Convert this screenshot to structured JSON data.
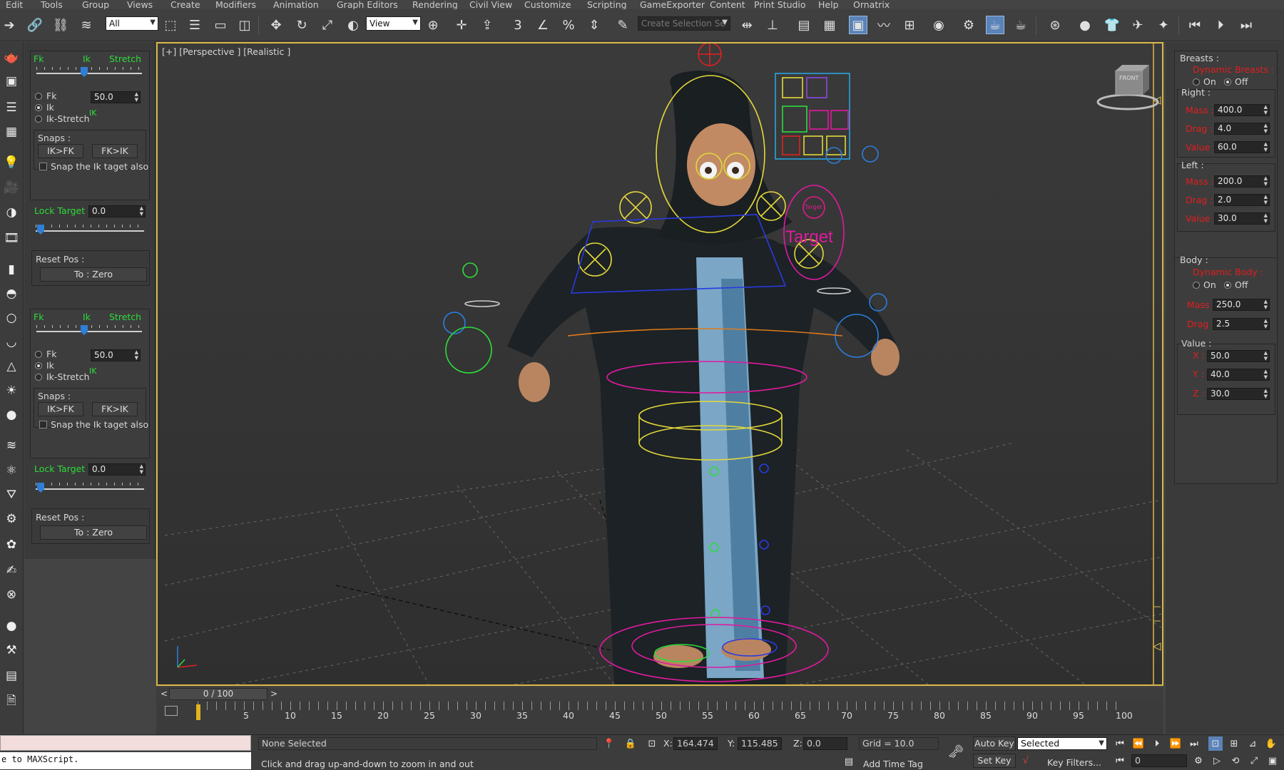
{
  "menubar": {
    "items": [
      "Edit",
      "Tools",
      "Group",
      "Views",
      "Create",
      "Modifiers",
      "Animation",
      "Graph Editors",
      "Rendering",
      "Civil View",
      "Customize",
      "Scripting",
      "GameExporter",
      "Content",
      "Print Studio",
      "Help",
      "Ornatrix"
    ]
  },
  "toolbar": {
    "selection_filter": "All",
    "reference_coord": "View",
    "named_selection_placeholder": "Create Selection Se"
  },
  "left_panel": {
    "groups": [
      {
        "fk_label": "Fk",
        "ik_label": "Ik",
        "stretch_label": "Stretch",
        "radio_fk": "Fk",
        "radio_ik": "Ik",
        "radio_ikstretch": "Ik-Stretch",
        "blend_value": "50.0",
        "mode_indicator": "IK",
        "slider_percent": 50,
        "snaps_label": "Snaps :",
        "ik_to_fk": "IK>FK",
        "fk_to_ik": "FK>IK",
        "snap_checkbox_label": "Snap the Ik taget also",
        "lock_target_label": "Lock Target",
        "lock_target_value": "0.0",
        "lock_slider_percent": 0,
        "reset_pos_label": "Reset Pos :",
        "to_zero": "To : Zero"
      },
      {
        "fk_label": "Fk",
        "ik_label": "Ik",
        "stretch_label": "Stretch",
        "radio_fk": "Fk",
        "radio_ik": "Ik",
        "radio_ikstretch": "Ik-Stretch",
        "blend_value": "50.0",
        "mode_indicator": "IK",
        "slider_percent": 50,
        "snaps_label": "Snaps :",
        "ik_to_fk": "IK>FK",
        "fk_to_ik": "FK>IK",
        "snap_checkbox_label": "Snap the Ik taget also",
        "lock_target_label": "Lock Target",
        "lock_target_value": "0.0",
        "lock_slider_percent": 0,
        "reset_pos_label": "Reset Pos :",
        "to_zero": "To : Zero"
      }
    ]
  },
  "viewport": {
    "label": "[+] [Perspective ] [Realistic ]",
    "target_text": "Target",
    "target_small": "Target",
    "viewcube_face": "FRONT"
  },
  "right_panel": {
    "breasts_label": "Breasts :",
    "dynamic_breasts": "Dynamic Breasts :",
    "on": "On",
    "off": "Off",
    "right_label": "Right :",
    "mass_label": "Mass :",
    "drag_label": "Drag :",
    "value_label": "Value :",
    "right_mass": "400.0",
    "right_drag": "4.0",
    "right_value": "60.0",
    "left_label": "Left :",
    "left_mass": "200.0",
    "left_drag": "2.0",
    "left_value": "30.0",
    "body_label": "Body :",
    "dynamic_body": "Dynamic Body :",
    "body_mass": "250.0",
    "body_drag": "2.5",
    "value_group_label": "Value :",
    "x_label": "X :",
    "y_label": "Y :",
    "z_label": "Z :",
    "x_value": "50.0",
    "y_value": "40.0",
    "z_value": "30.0"
  },
  "timeline": {
    "frame_display": "0 / 100",
    "prev": "<",
    "next": ">",
    "ticks": [
      "5",
      "10",
      "15",
      "20",
      "25",
      "30",
      "35",
      "40",
      "45",
      "50",
      "55",
      "60",
      "65",
      "70",
      "75",
      "80",
      "85",
      "90",
      "95",
      "100"
    ]
  },
  "statusbar": {
    "maxscript": "e to MAXScript.",
    "selection_status": "None Selected",
    "prompt": "Click and drag up-and-down to zoom in and out",
    "x_label": "X:",
    "x_value": "164.474",
    "y_label": "Y:",
    "y_value": "115.485",
    "z_label": "Z:",
    "z_value": "0.0",
    "grid": "Grid = 10.0",
    "add_time_tag": "Add Time Tag",
    "auto_key": "Auto Key",
    "set_key": "Set Key",
    "key_mode": "Selected",
    "key_filters": "Key Filters...",
    "current_frame": "0"
  },
  "colors": {
    "viewport_border": "#d9b84a",
    "green_label": "#2ddc3a",
    "red_label": "#e41d1d",
    "slider_blue": "#2f7fd6"
  }
}
